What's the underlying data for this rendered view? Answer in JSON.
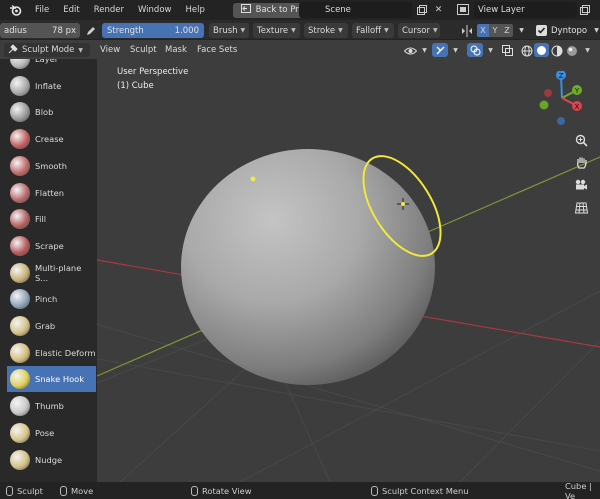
{
  "topbar": {
    "menus": [
      "File",
      "Edit",
      "Render",
      "Window",
      "Help"
    ],
    "back_button": "Back to Previous",
    "scene": "Scene",
    "view_layer": "View Layer"
  },
  "tool_settings": {
    "radius_label": "adius",
    "radius_value": "78 px",
    "strength_label": "Strength",
    "strength_value": "1.000",
    "dropdowns": [
      "Brush",
      "Texture",
      "Stroke",
      "Falloff",
      "Cursor"
    ],
    "axes": [
      "X",
      "Y",
      "Z"
    ],
    "dyntopo": "Dyntopo"
  },
  "viewport_header": {
    "mode": "Sculpt Mode",
    "menus": [
      "View",
      "Sculpt",
      "Mask",
      "Face Sets"
    ]
  },
  "viewport": {
    "perspective": "User Perspective",
    "object": "(1) Cube",
    "gizmo": {
      "x": "X",
      "y": "Y",
      "z": "Z"
    }
  },
  "brushes": [
    {
      "label": "Layer",
      "color": "#b8b8b8"
    },
    {
      "label": "Inflate",
      "color": "#a9a9a9"
    },
    {
      "label": "Blob",
      "color": "#9a9a9a"
    },
    {
      "label": "Crease",
      "color": "#c06060"
    },
    {
      "label": "Smooth",
      "color": "#c06a6a"
    },
    {
      "label": "Flatten",
      "color": "#b86a6a"
    },
    {
      "label": "Fill",
      "color": "#b46060"
    },
    {
      "label": "Scrape",
      "color": "#b65a5a"
    },
    {
      "label": "Multi-plane S...",
      "color": "#c7b27a"
    },
    {
      "label": "Pinch",
      "color": "#8ea3b9"
    },
    {
      "label": "Grab",
      "color": "#d3c288"
    },
    {
      "label": "Elastic Deform",
      "color": "#d4bd7c"
    },
    {
      "label": "Snake Hook",
      "color": "#e0cf58",
      "active": true
    },
    {
      "label": "Thumb",
      "color": "#c8c8c8"
    },
    {
      "label": "Pose",
      "color": "#d6c48a"
    },
    {
      "label": "Nudge",
      "color": "#d2c186"
    }
  ],
  "statusbar": {
    "left_label": "Sculpt",
    "move_label": "Move",
    "rotate_label": "Rotate View",
    "context_label": "Sculpt Context Menu",
    "right_text": "Cube | Ve"
  },
  "colors": {
    "accent": "#4772b3",
    "axis_x": "#e0424f",
    "axis_y": "#6fae24",
    "axis_z": "#3a8fe0",
    "brush_circle": "#f0e83a"
  }
}
